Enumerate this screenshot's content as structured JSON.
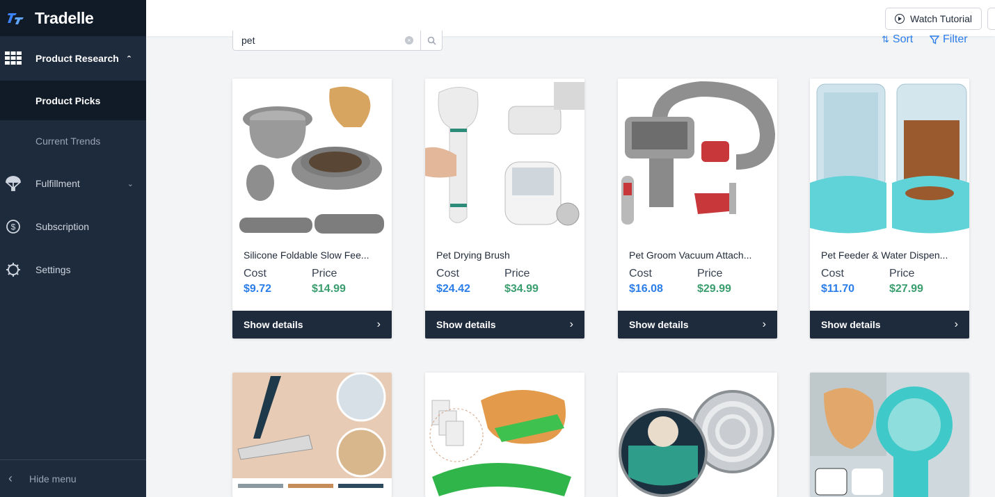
{
  "brand": {
    "name": "Tradelle"
  },
  "sidebar": {
    "product_research": "Product Research",
    "product_picks": "Product Picks",
    "current_trends": "Current Trends",
    "fulfillment": "Fulfillment",
    "subscription": "Subscription",
    "settings": "Settings",
    "hide_menu": "Hide menu"
  },
  "topbar": {
    "watch_tutorial": "Watch Tutorial"
  },
  "search": {
    "value": "pet"
  },
  "toolbar": {
    "sort": "Sort",
    "filter": "Filter"
  },
  "labels": {
    "cost": "Cost",
    "price": "Price",
    "show_details": "Show details"
  },
  "products": [
    {
      "title": "Silicone Foldable Slow Fee...",
      "cost": "$9.72",
      "price": "$14.99"
    },
    {
      "title": "Pet Drying Brush",
      "cost": "$24.42",
      "price": "$34.99"
    },
    {
      "title": "Pet Groom Vacuum Attach...",
      "cost": "$16.08",
      "price": "$29.99"
    },
    {
      "title": "Pet Feeder & Water Dispen...",
      "cost": "$11.70",
      "price": "$27.99"
    }
  ],
  "product_images_row2": [
    "lint-roller-image",
    "cat-fish-toy-image",
    "flea-collar-image",
    "treat-wheel-image"
  ],
  "colors": {
    "sidebar": "#1e2b3c",
    "accent": "#2b7de9",
    "price": "#3a9e6e"
  }
}
